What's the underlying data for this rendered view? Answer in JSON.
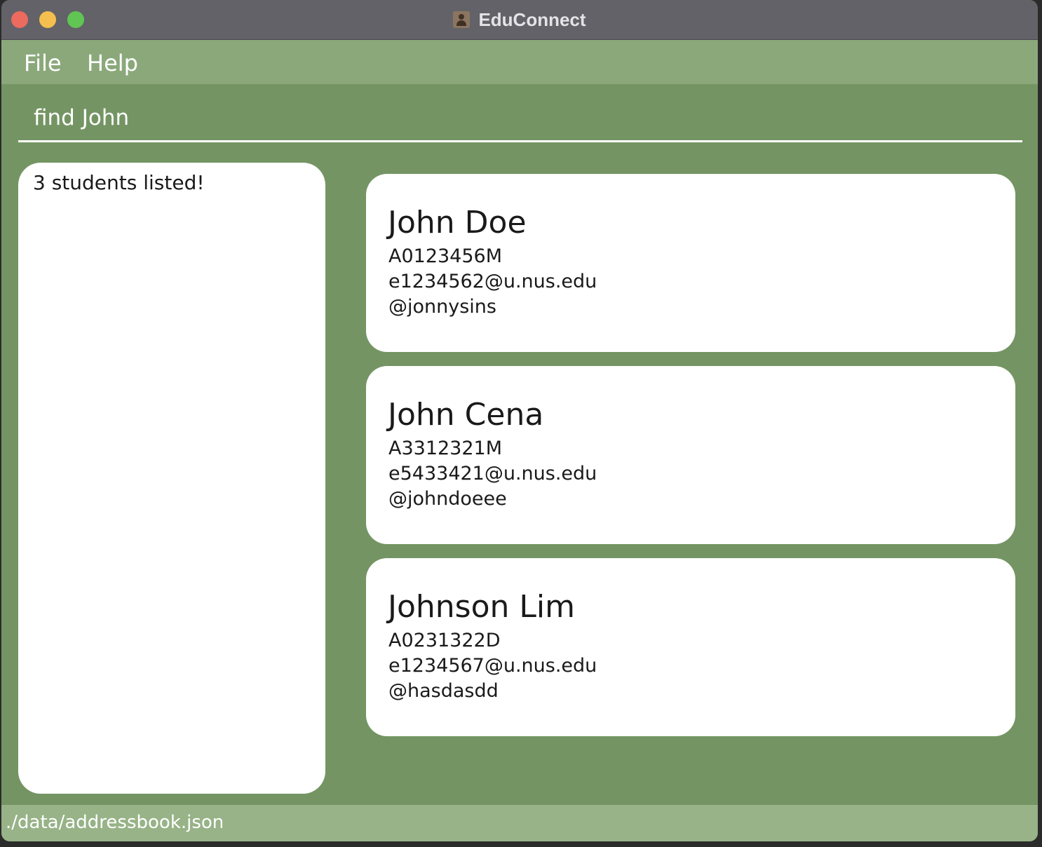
{
  "colors": {
    "titlebar": "#636268",
    "bg_main": "#749563",
    "bg_menu": "#8ba87b",
    "bg_status": "#97b387"
  },
  "window": {
    "title": "EduConnect",
    "app_icon": "contact-card-icon"
  },
  "menubar": {
    "file_label": "File",
    "help_label": "Help"
  },
  "command": {
    "value": "find John"
  },
  "result": {
    "text": "3 students listed!"
  },
  "students": [
    {
      "name": "John Doe",
      "id": "A0123456M",
      "email": "e1234562@u.nus.edu",
      "handle": "@jonnysins"
    },
    {
      "name": "John Cena",
      "id": "A3312321M",
      "email": "e5433421@u.nus.edu",
      "handle": "@johndoeee"
    },
    {
      "name": "Johnson Lim",
      "id": "A0231322D",
      "email": "e1234567@u.nus.edu",
      "handle": "@hasdasdd"
    }
  ],
  "statusbar": {
    "path": "./data/addressbook.json"
  }
}
